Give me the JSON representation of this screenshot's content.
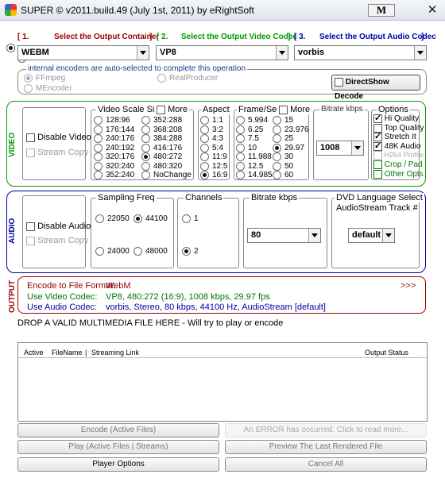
{
  "window": {
    "title": "SUPER © v2011.build.49 (July 1st, 2011) by eRightSoft",
    "m_button": "M",
    "close": "✕"
  },
  "output": {
    "container_label": "Select the Output Container",
    "container_num": "[ 1.",
    "container_close": "]",
    "container_value": "WEBM",
    "video_codec_num": "[ 2.",
    "video_codec_label": "Select the Output Video Codec",
    "video_codec_close": "]",
    "video_codec_value": "VP8",
    "audio_codec_num": "[ 3.",
    "audio_codec_label": "Select the Output Audio Codec",
    "audio_codec_close": "]",
    "audio_codec_value": "vorbis"
  },
  "encoders": {
    "title": "internal encoders are auto-selected to complete this operation",
    "ffmpeg": "FFmpeg",
    "mencoder": "MEncoder",
    "realproducer": "RealProducer",
    "directshow": "DirectShow Decode"
  },
  "video": {
    "side": "VIDEO",
    "disable": "Disable Video",
    "stream_copy": "Stream Copy",
    "scale_title": "Video Scale Size",
    "more": "More",
    "sizes_left": [
      "128:96",
      "176:144",
      "240:176",
      "240:192",
      "320:176",
      "320:240",
      "352:240"
    ],
    "sizes_right": [
      "352:288",
      "368:208",
      "384:288",
      "416:176",
      "480:272",
      "480:320",
      "NoChange"
    ],
    "aspect_title": "Aspect",
    "aspects": [
      "1:1",
      "3:2",
      "4:3",
      "5:4",
      "11:9",
      "12:5",
      "16:9"
    ],
    "fps_title": "Frame/Sec",
    "fps_left": [
      "5.994",
      "6.25",
      "7.5",
      "10",
      "11.988",
      "12.5",
      "14.985"
    ],
    "fps_right": [
      "15",
      "23.976",
      "25",
      "29.97",
      "30",
      "50",
      "60"
    ],
    "bitrate_title": "Bitrate  kbps",
    "bitrate_value": "1008",
    "options_title": "Options",
    "options": [
      "Hi Quality",
      "Top Quality",
      "Stretch It",
      "48K Audio",
      "H264 Profile"
    ],
    "crop": "Crop / Pad",
    "other": "Other Opts"
  },
  "audio": {
    "side": "AUDIO",
    "disable": "Disable Audio",
    "stream_copy": "Stream Copy",
    "freq_title": "Sampling Freq",
    "freqs": [
      "22050",
      "44100",
      "24000",
      "48000"
    ],
    "channels_title": "Channels",
    "channels": [
      "1",
      "2"
    ],
    "bitrate_title": "Bitrate  kbps",
    "bitrate_value": "80",
    "dvd_title": "DVD Language Select",
    "dvd_sub": "AudioStream  Track #",
    "dvd_value": "default"
  },
  "summary": {
    "side": "OUTPUT",
    "fmt_label": "Encode to File Format:",
    "fmt_value": "WebM",
    "arrows": ">>>",
    "vcodec_label": "Use Video Codec:",
    "vcodec_value": "VP8,  480:272 (16:9),  1008 kbps,  29.97 fps",
    "acodec_label": "Use Audio Codec:",
    "acodec_value": "vorbis,  Stereo,  80 kbps,  44100 Hz,  AudioStream [default]"
  },
  "drop_text": "DROP A VALID MULTIMEDIA FILE HERE - Will try to play or encode",
  "table": {
    "col_active": "Active",
    "col_filename": "FileName",
    "col_sep": "|",
    "col_stream": "Streaming Link",
    "col_status": "Output Status"
  },
  "buttons": {
    "encode": "Encode (Active Files)",
    "error": "An ERROR has occurred. Click to read more...",
    "play": "Play (Active Files | Streams)",
    "preview": "Preview The Last Rendered File",
    "player_options": "Player Options",
    "cancel": "Cancel All"
  },
  "colors": {
    "red": "#990000",
    "green": "#009900",
    "blue": "#0000aa"
  }
}
